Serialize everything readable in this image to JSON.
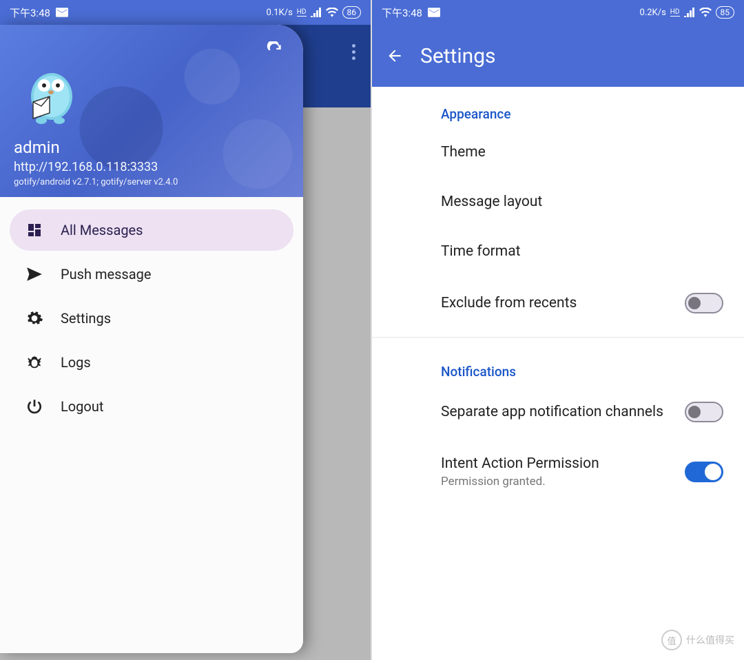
{
  "left": {
    "status": {
      "time": "下午3:48",
      "net": "0.1K/s",
      "hd": "HD",
      "battery": "86"
    },
    "drawer": {
      "user": "admin",
      "url": "http://192.168.0.118:3333",
      "version": "gotify/android v2.7.1; gotify/server v2.4.0",
      "items": [
        {
          "label": "All Messages",
          "icon": "dashboard-icon",
          "active": true
        },
        {
          "label": "Push message",
          "icon": "send-icon",
          "active": false
        },
        {
          "label": "Settings",
          "icon": "gear-icon",
          "active": false
        },
        {
          "label": "Logs",
          "icon": "bug-icon",
          "active": false
        },
        {
          "label": "Logout",
          "icon": "power-icon",
          "active": false
        }
      ]
    }
  },
  "right": {
    "status": {
      "time": "下午3:48",
      "net": "0.2K/s",
      "hd": "HD",
      "battery": "85"
    },
    "appbar": {
      "title": "Settings"
    },
    "sections": [
      {
        "header": "Appearance",
        "rows": [
          {
            "title": "Theme",
            "toggle": null
          },
          {
            "title": "Message layout",
            "toggle": null
          },
          {
            "title": "Time format",
            "toggle": null
          },
          {
            "title": "Exclude from recents",
            "toggle": false
          }
        ]
      },
      {
        "header": "Notifications",
        "rows": [
          {
            "title": "Separate app notification channels",
            "toggle": false
          },
          {
            "title": "Intent Action Permission",
            "sub": "Permission granted.",
            "toggle": true
          }
        ]
      }
    ]
  },
  "watermark": {
    "badge": "值",
    "text": "什么值得买"
  }
}
